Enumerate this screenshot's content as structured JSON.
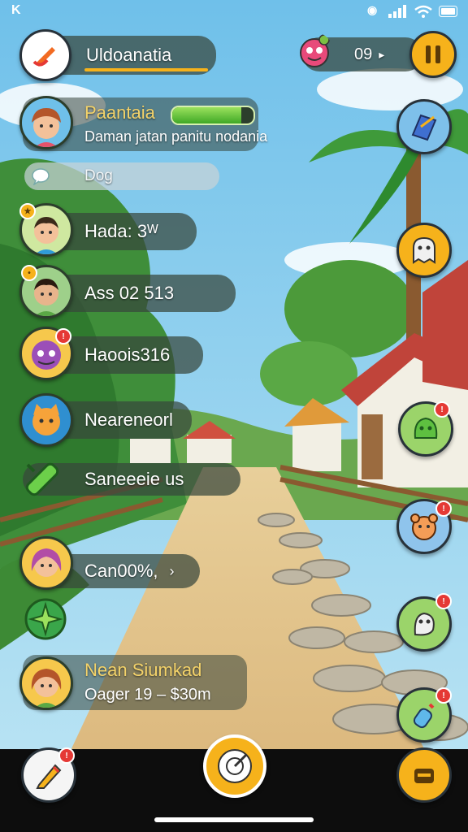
{
  "status_bar": {
    "left_glyph": "K"
  },
  "header": {
    "player_name": "Uldoanatia",
    "resource_value": "09",
    "resource_arrow": "▸"
  },
  "profile": {
    "name": "Paantaia",
    "subtitle": "Daman  jatan panitu nodania",
    "energy_fraction": 0.85
  },
  "search": {
    "text": "Dog"
  },
  "list": [
    {
      "label": "Hada: 3ᵂ"
    },
    {
      "label": "Ass 02 513"
    },
    {
      "label": "Haoois316"
    },
    {
      "label": "Neareneorl"
    },
    {
      "label": "Saneeeie us"
    },
    {
      "label": "Can00%,",
      "chevron": "›"
    }
  ],
  "featured": {
    "name": "Nean Siumkad",
    "detail": "Oager  19 – $30m"
  },
  "colors": {
    "accent_yellow": "#f6b21b",
    "name_yellow": "#f4d36a",
    "pill_bg": "#374640",
    "badge_red": "#e53935"
  }
}
